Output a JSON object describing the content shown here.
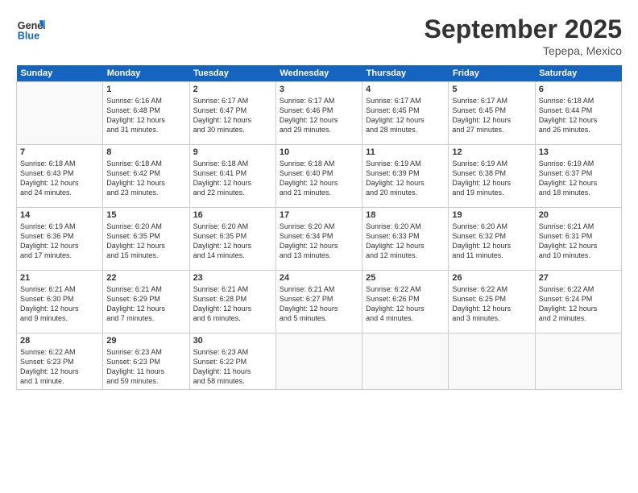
{
  "logo": {
    "line1": "General",
    "line2": "Blue"
  },
  "title": "September 2025",
  "subtitle": "Tepepa, Mexico",
  "days_of_week": [
    "Sunday",
    "Monday",
    "Tuesday",
    "Wednesday",
    "Thursday",
    "Friday",
    "Saturday"
  ],
  "weeks": [
    [
      {
        "num": "",
        "text": ""
      },
      {
        "num": "1",
        "text": "Sunrise: 6:16 AM\nSunset: 6:48 PM\nDaylight: 12 hours\nand 31 minutes."
      },
      {
        "num": "2",
        "text": "Sunrise: 6:17 AM\nSunset: 6:47 PM\nDaylight: 12 hours\nand 30 minutes."
      },
      {
        "num": "3",
        "text": "Sunrise: 6:17 AM\nSunset: 6:46 PM\nDaylight: 12 hours\nand 29 minutes."
      },
      {
        "num": "4",
        "text": "Sunrise: 6:17 AM\nSunset: 6:45 PM\nDaylight: 12 hours\nand 28 minutes."
      },
      {
        "num": "5",
        "text": "Sunrise: 6:17 AM\nSunset: 6:45 PM\nDaylight: 12 hours\nand 27 minutes."
      },
      {
        "num": "6",
        "text": "Sunrise: 6:18 AM\nSunset: 6:44 PM\nDaylight: 12 hours\nand 26 minutes."
      }
    ],
    [
      {
        "num": "7",
        "text": "Sunrise: 6:18 AM\nSunset: 6:43 PM\nDaylight: 12 hours\nand 24 minutes."
      },
      {
        "num": "8",
        "text": "Sunrise: 6:18 AM\nSunset: 6:42 PM\nDaylight: 12 hours\nand 23 minutes."
      },
      {
        "num": "9",
        "text": "Sunrise: 6:18 AM\nSunset: 6:41 PM\nDaylight: 12 hours\nand 22 minutes."
      },
      {
        "num": "10",
        "text": "Sunrise: 6:18 AM\nSunset: 6:40 PM\nDaylight: 12 hours\nand 21 minutes."
      },
      {
        "num": "11",
        "text": "Sunrise: 6:19 AM\nSunset: 6:39 PM\nDaylight: 12 hours\nand 20 minutes."
      },
      {
        "num": "12",
        "text": "Sunrise: 6:19 AM\nSunset: 6:38 PM\nDaylight: 12 hours\nand 19 minutes."
      },
      {
        "num": "13",
        "text": "Sunrise: 6:19 AM\nSunset: 6:37 PM\nDaylight: 12 hours\nand 18 minutes."
      }
    ],
    [
      {
        "num": "14",
        "text": "Sunrise: 6:19 AM\nSunset: 6:36 PM\nDaylight: 12 hours\nand 17 minutes."
      },
      {
        "num": "15",
        "text": "Sunrise: 6:20 AM\nSunset: 6:35 PM\nDaylight: 12 hours\nand 15 minutes."
      },
      {
        "num": "16",
        "text": "Sunrise: 6:20 AM\nSunset: 6:35 PM\nDaylight: 12 hours\nand 14 minutes."
      },
      {
        "num": "17",
        "text": "Sunrise: 6:20 AM\nSunset: 6:34 PM\nDaylight: 12 hours\nand 13 minutes."
      },
      {
        "num": "18",
        "text": "Sunrise: 6:20 AM\nSunset: 6:33 PM\nDaylight: 12 hours\nand 12 minutes."
      },
      {
        "num": "19",
        "text": "Sunrise: 6:20 AM\nSunset: 6:32 PM\nDaylight: 12 hours\nand 11 minutes."
      },
      {
        "num": "20",
        "text": "Sunrise: 6:21 AM\nSunset: 6:31 PM\nDaylight: 12 hours\nand 10 minutes."
      }
    ],
    [
      {
        "num": "21",
        "text": "Sunrise: 6:21 AM\nSunset: 6:30 PM\nDaylight: 12 hours\nand 9 minutes."
      },
      {
        "num": "22",
        "text": "Sunrise: 6:21 AM\nSunset: 6:29 PM\nDaylight: 12 hours\nand 7 minutes."
      },
      {
        "num": "23",
        "text": "Sunrise: 6:21 AM\nSunset: 6:28 PM\nDaylight: 12 hours\nand 6 minutes."
      },
      {
        "num": "24",
        "text": "Sunrise: 6:21 AM\nSunset: 6:27 PM\nDaylight: 12 hours\nand 5 minutes."
      },
      {
        "num": "25",
        "text": "Sunrise: 6:22 AM\nSunset: 6:26 PM\nDaylight: 12 hours\nand 4 minutes."
      },
      {
        "num": "26",
        "text": "Sunrise: 6:22 AM\nSunset: 6:25 PM\nDaylight: 12 hours\nand 3 minutes."
      },
      {
        "num": "27",
        "text": "Sunrise: 6:22 AM\nSunset: 6:24 PM\nDaylight: 12 hours\nand 2 minutes."
      }
    ],
    [
      {
        "num": "28",
        "text": "Sunrise: 6:22 AM\nSunset: 6:23 PM\nDaylight: 12 hours\nand 1 minute."
      },
      {
        "num": "29",
        "text": "Sunrise: 6:23 AM\nSunset: 6:23 PM\nDaylight: 11 hours\nand 59 minutes."
      },
      {
        "num": "30",
        "text": "Sunrise: 6:23 AM\nSunset: 6:22 PM\nDaylight: 11 hours\nand 58 minutes."
      },
      {
        "num": "",
        "text": ""
      },
      {
        "num": "",
        "text": ""
      },
      {
        "num": "",
        "text": ""
      },
      {
        "num": "",
        "text": ""
      }
    ]
  ]
}
